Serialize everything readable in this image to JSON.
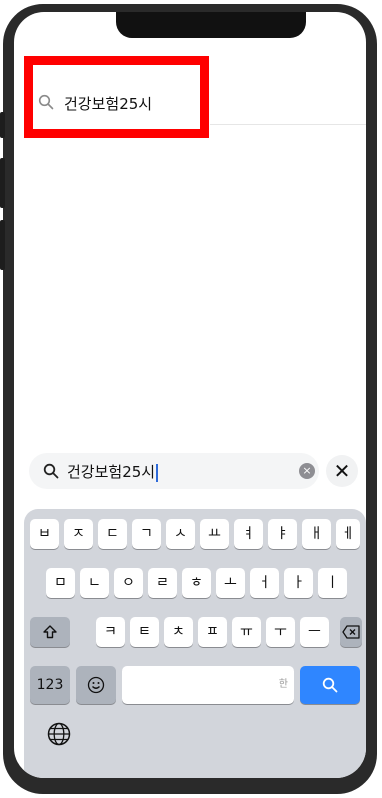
{
  "top_search": {
    "query": "건강보험25시"
  },
  "search_bar": {
    "query": "건강보험25시",
    "clear_label": "×",
    "close_label": "✕"
  },
  "keyboard": {
    "row1": [
      "ㅂ",
      "ㅈ",
      "ㄷ",
      "ㄱ",
      "ㅅ",
      "ㅛ",
      "ㅕ",
      "ㅑ",
      "ㅐ",
      "ㅔ"
    ],
    "row2": [
      "ㅁ",
      "ㄴ",
      "ㅇ",
      "ㄹ",
      "ㅎ",
      "ㅗ",
      "ㅓ",
      "ㅏ",
      "ㅣ"
    ],
    "row3": [
      "ㅋ",
      "ㅌ",
      "ㅊ",
      "ㅍ",
      "ㅠ",
      "ㅜ",
      "ㅡ"
    ],
    "num_label": "123",
    "space_hint": "한"
  }
}
